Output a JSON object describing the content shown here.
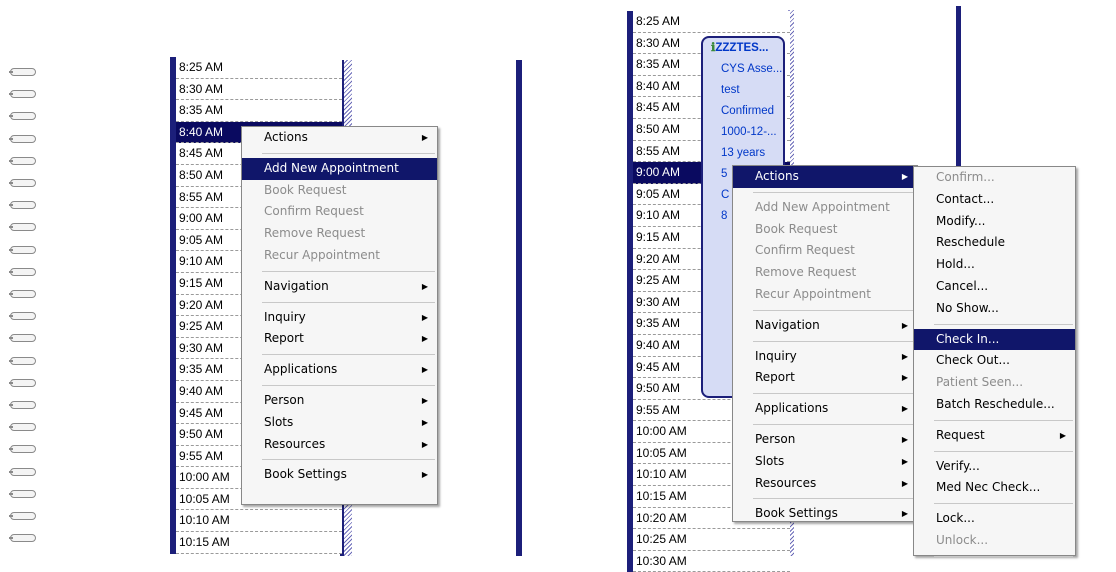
{
  "left_panel": {
    "times": [
      "8:25 AM",
      "8:30 AM",
      "8:35 AM",
      "8:40 AM",
      "8:45 AM",
      "8:50 AM",
      "8:55 AM",
      "9:00 AM",
      "9:05 AM",
      "9:10 AM",
      "9:15 AM",
      "9:20 AM",
      "9:25 AM",
      "9:30 AM",
      "9:35 AM",
      "9:40 AM",
      "9:45 AM",
      "9:50 AM",
      "9:55 AM",
      "10:00 AM",
      "10:05 AM",
      "10:10 AM",
      "10:15 AM"
    ],
    "selected_time": "8:40 AM",
    "context_menu": [
      {
        "label": "Actions",
        "submenu": true
      },
      {
        "sep": true
      },
      {
        "label": "Add New Appointment",
        "highlighted": true
      },
      {
        "label": "Book Request",
        "disabled": true
      },
      {
        "label": "Confirm Request",
        "disabled": true
      },
      {
        "label": "Remove Request",
        "disabled": true
      },
      {
        "label": "Recur Appointment",
        "disabled": true
      },
      {
        "sep": true
      },
      {
        "label": "Navigation",
        "submenu": true
      },
      {
        "sep": true
      },
      {
        "label": "Inquiry",
        "submenu": true
      },
      {
        "label": "Report",
        "submenu": true
      },
      {
        "sep": true
      },
      {
        "label": "Applications",
        "submenu": true
      },
      {
        "sep": true
      },
      {
        "label": "Person",
        "submenu": true
      },
      {
        "label": "Slots",
        "submenu": true
      },
      {
        "label": "Resources",
        "submenu": true
      },
      {
        "sep": true
      },
      {
        "label": "Book Settings",
        "submenu": true
      }
    ]
  },
  "right_panel": {
    "times": [
      "8:25 AM",
      "8:30 AM",
      "8:35 AM",
      "8:40 AM",
      "8:45 AM",
      "8:50 AM",
      "8:55 AM",
      "9:00 AM",
      "9:05 AM",
      "9:10 AM",
      "9:15 AM",
      "9:20 AM",
      "9:25 AM",
      "9:30 AM",
      "9:35 AM",
      "9:40 AM",
      "9:45 AM",
      "9:50 AM",
      "9:55 AM",
      "10:00 AM",
      "10:05 AM",
      "10:10 AM",
      "10:15 AM",
      "10:20 AM",
      "10:25 AM",
      "10:30 AM"
    ],
    "selected_time": "9:00 AM",
    "appointment": {
      "icon": "info-icon",
      "lines": [
        "ZZZTES...",
        "CYS Asse...",
        "test",
        "Confirmed",
        "1000-12-...",
        "13 years",
        "5",
        "C",
        "8"
      ]
    },
    "context_menu": [
      {
        "label": "Actions",
        "submenu": true,
        "highlighted": true
      },
      {
        "sep": true
      },
      {
        "label": "Add New Appointment",
        "disabled": true
      },
      {
        "label": "Book Request",
        "disabled": true
      },
      {
        "label": "Confirm Request",
        "disabled": true
      },
      {
        "label": "Remove Request",
        "disabled": true
      },
      {
        "label": "Recur Appointment",
        "disabled": true
      },
      {
        "sep": true
      },
      {
        "label": "Navigation",
        "submenu": true
      },
      {
        "sep": true
      },
      {
        "label": "Inquiry",
        "submenu": true
      },
      {
        "label": "Report",
        "submenu": true
      },
      {
        "sep": true
      },
      {
        "label": "Applications",
        "submenu": true
      },
      {
        "sep": true
      },
      {
        "label": "Person",
        "submenu": true
      },
      {
        "label": "Slots",
        "submenu": true
      },
      {
        "label": "Resources",
        "submenu": true
      },
      {
        "sep": true
      },
      {
        "label": "Book Settings",
        "submenu": true
      }
    ],
    "actions_submenu": [
      {
        "label": "Confirm...",
        "disabled": true
      },
      {
        "label": "Contact..."
      },
      {
        "label": "Modify..."
      },
      {
        "label": "Reschedule"
      },
      {
        "label": "Hold..."
      },
      {
        "label": "Cancel..."
      },
      {
        "label": "No Show..."
      },
      {
        "sep": true
      },
      {
        "label": "Check In...",
        "highlighted": true
      },
      {
        "label": "Check Out..."
      },
      {
        "label": "Patient Seen...",
        "disabled": true
      },
      {
        "label": "Batch Reschedule..."
      },
      {
        "sep": true
      },
      {
        "label": "Request",
        "submenu": true
      },
      {
        "sep": true
      },
      {
        "label": "Verify..."
      },
      {
        "label": "Med Nec Check..."
      },
      {
        "sep": true
      },
      {
        "label": "Lock..."
      },
      {
        "label": "Unlock...",
        "disabled": true
      },
      {
        "sep": true
      }
    ]
  },
  "colors": {
    "navy": "#1c1f7a",
    "highlight": "#10166a",
    "appointment_bg": "#d6dcf5",
    "appointment_text": "#0037c8"
  }
}
